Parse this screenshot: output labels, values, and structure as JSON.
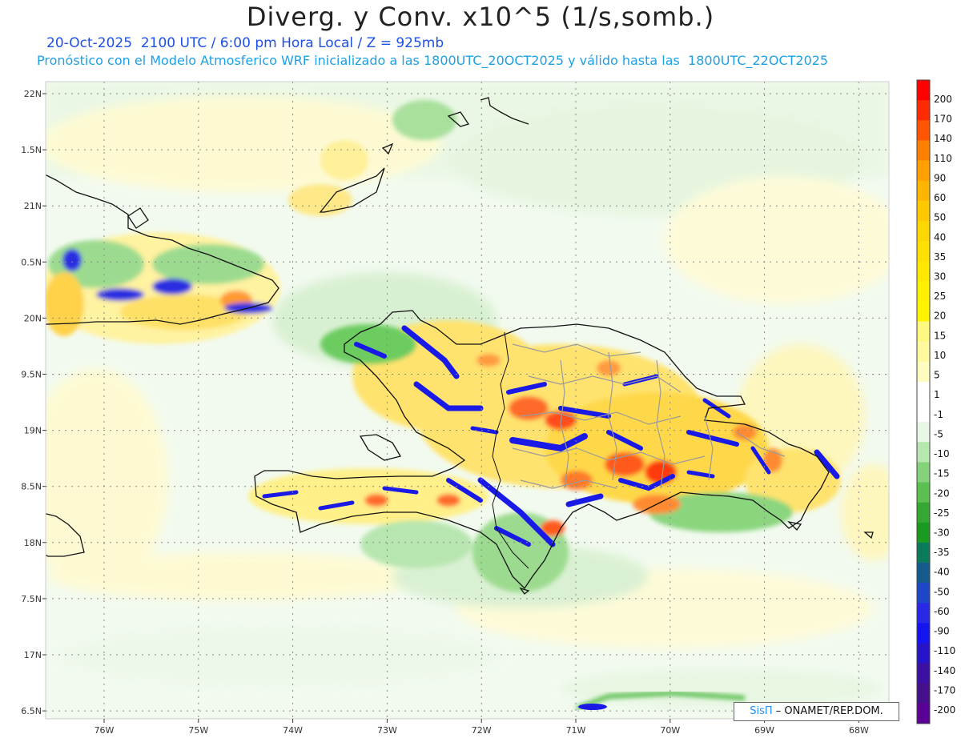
{
  "header": {
    "title": "Diverg. y Conv. x10^5 (1/s,somb.)",
    "valid_line": "20-Oct-2025  2100 UTC / 6:00 pm Hora Local / Z = 925mb",
    "model_line": "Pronóstico con el Modelo Atmosferico WRF inicializado a las 1800UTC_20OCT2025 y válido hasta las  1800UTC_22OCT2025"
  },
  "map": {
    "lat_labels": [
      "22N",
      "1.5N",
      "21N",
      "0.5N",
      "20N",
      "9.5N",
      "19N",
      "8.5N",
      "18N",
      "7.5N",
      "17N",
      "6.5N"
    ],
    "lon_labels": [
      "76W",
      "75W",
      "74W",
      "73W",
      "72W",
      "71W",
      "70W",
      "69W",
      "68W"
    ],
    "extent": {
      "lon_min": -76.6,
      "lon_max": -67.7,
      "lat_min": 16.45,
      "lat_max": 22.1
    }
  },
  "colorbar": {
    "labels": [
      "200",
      "170",
      "140",
      "110",
      "90",
      "60",
      "50",
      "40",
      "35",
      "30",
      "25",
      "20",
      "15",
      "10",
      "5",
      "1",
      "-1",
      "-5",
      "-10",
      "-15",
      "-20",
      "-25",
      "-30",
      "-35",
      "-40",
      "-50",
      "-60",
      "-90",
      "-110",
      "-140",
      "-170",
      "-200"
    ],
    "colors": [
      "#ff0000",
      "#ff2a00",
      "#ff5500",
      "#ff8000",
      "#ffa000",
      "#ffb400",
      "#ffc800",
      "#ffd700",
      "#ffe000",
      "#ffe800",
      "#fff000",
      "#fff400",
      "#fff880",
      "#fffaa0",
      "#fffcc0",
      "#ffffff",
      "#ffffff",
      "#e8f7e6",
      "#b8e6b0",
      "#86d17c",
      "#5cbf52",
      "#34a832",
      "#1a9a20",
      "#0a7a5a",
      "#145a8c",
      "#1e46c8",
      "#2828e6",
      "#1414f0",
      "#2814c8",
      "#3c10a0",
      "#46108c",
      "#5a0096"
    ]
  },
  "credit": {
    "sis": "SisΠ",
    "rest": " – ONAMET/REP.DOM."
  }
}
